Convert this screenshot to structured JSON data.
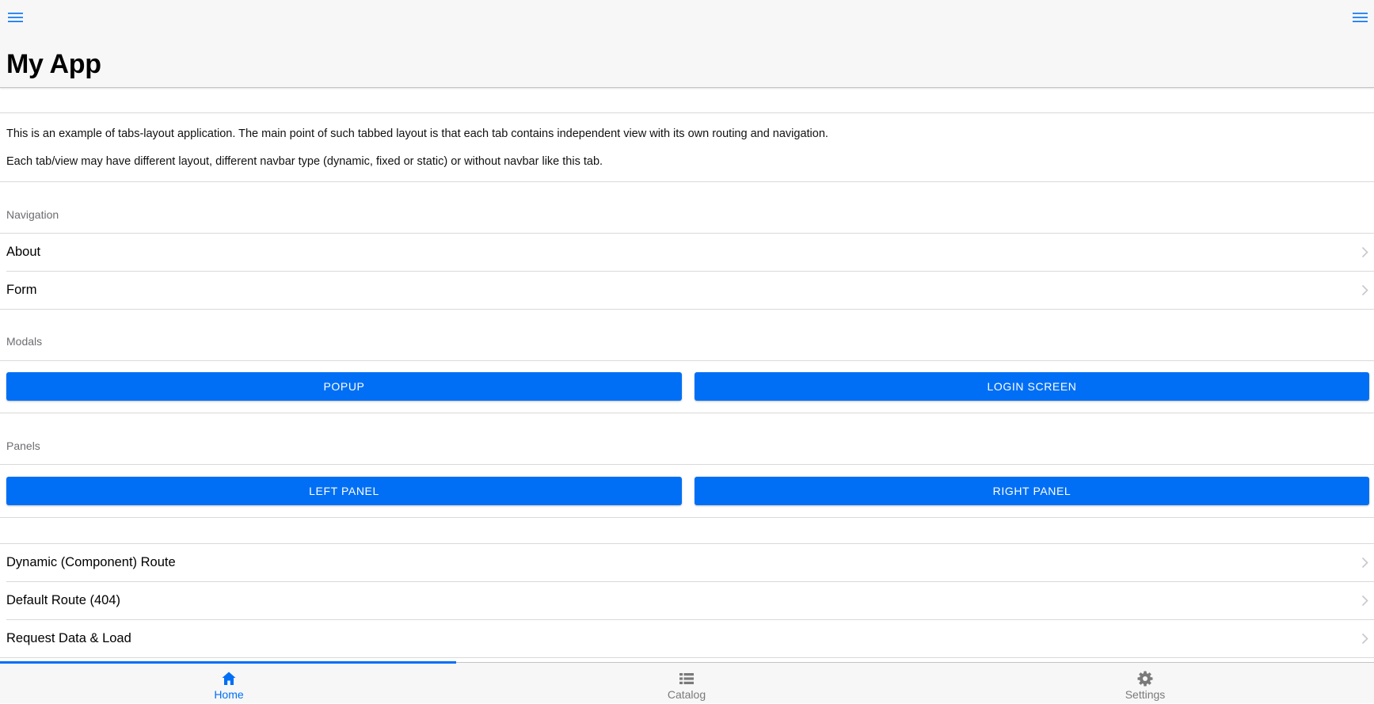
{
  "navbar": {
    "title": "My App",
    "left_icon": "menu-icon",
    "right_icon": "menu-icon"
  },
  "intro": {
    "paragraph1": "This is an example of tabs-layout application. The main point of such tabbed layout is that each tab contains independent view with its own routing and navigation.",
    "paragraph2": "Each tab/view may have different layout, different navbar type (dynamic, fixed or static) or without navbar like this tab."
  },
  "navigation": {
    "title": "Navigation",
    "items": [
      {
        "label": "About"
      },
      {
        "label": "Form"
      }
    ]
  },
  "modals": {
    "title": "Modals",
    "buttons": [
      {
        "label": "POPUP"
      },
      {
        "label": "LOGIN SCREEN"
      }
    ]
  },
  "panels": {
    "title": "Panels",
    "buttons": [
      {
        "label": "LEFT PANEL"
      },
      {
        "label": "RIGHT PANEL"
      }
    ]
  },
  "links": {
    "items": [
      {
        "label": "Dynamic (Component) Route"
      },
      {
        "label": "Default Route (404)"
      },
      {
        "label": "Request Data & Load"
      }
    ]
  },
  "tabbar": {
    "active": "Home",
    "tabs": [
      {
        "label": "Home",
        "icon": "house-icon"
      },
      {
        "label": "Catalog",
        "icon": "list-icon"
      },
      {
        "label": "Settings",
        "icon": "gear-icon"
      }
    ]
  },
  "colors": {
    "accent": "#006ff5",
    "bar_background": "#f7f7f7",
    "muted_text": "#6d6d72"
  }
}
